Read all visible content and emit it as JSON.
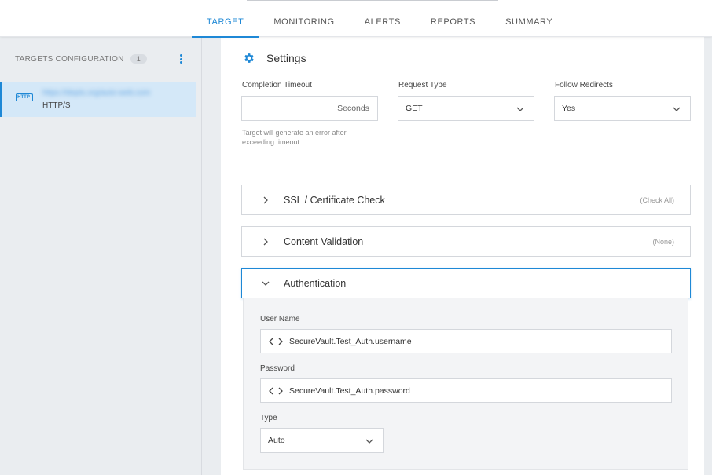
{
  "tabs": [
    {
      "label": "TARGET",
      "active": true
    },
    {
      "label": "MONITORING",
      "active": false
    },
    {
      "label": "ALERTS",
      "active": false
    },
    {
      "label": "REPORTS",
      "active": false
    },
    {
      "label": "SUMMARY",
      "active": false
    }
  ],
  "sidebar": {
    "header": "TARGETS CONFIGURATION",
    "count": "1",
    "target": {
      "icon": "http-icon",
      "icon_text": "HTTP",
      "url": "https://depts.org/auto-web.com",
      "type": "HTTP/S"
    }
  },
  "settings": {
    "title": "Settings",
    "icon": "gear-icon",
    "completion_timeout": {
      "label": "Completion Timeout",
      "value": "",
      "unit": "Seconds",
      "hint": "Target will generate an error after exceeding timeout."
    },
    "request_type": {
      "label": "Request Type",
      "value": "GET"
    },
    "follow_redirects": {
      "label": "Follow Redirects",
      "value": "Yes"
    }
  },
  "sections": {
    "ssl": {
      "title": "SSL / Certificate Check",
      "right": "(Check All)",
      "expanded": false
    },
    "content": {
      "title": "Content Validation",
      "right": "(None)",
      "expanded": false
    },
    "auth": {
      "title": "Authentication",
      "expanded": true
    }
  },
  "auth": {
    "username": {
      "label": "User Name",
      "value": "SecureVault.Test_Auth.username"
    },
    "password": {
      "label": "Password",
      "value": "SecureVault.Test_Auth.password"
    },
    "type": {
      "label": "Type",
      "value": "Auto"
    }
  },
  "colors": {
    "accent": "#1e88d6",
    "sidebar_bg": "#eaedf0",
    "selected_bg": "#d4e8f8",
    "auth_bg": "#f3f4f6"
  }
}
